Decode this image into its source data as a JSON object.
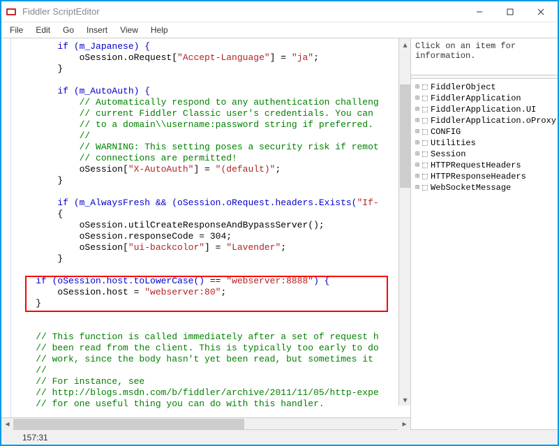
{
  "window": {
    "title": "Fiddler ScriptEditor"
  },
  "menu": {
    "file": "File",
    "edit": "Edit",
    "go": "Go",
    "insert": "Insert",
    "view": "View",
    "help": "Help"
  },
  "code": {
    "l1": "        if (m_Japanese) {",
    "l2a": "            oSession.oRequest[",
    "l2s": "\"Accept-Language\"",
    "l2b": "] = ",
    "l2s2": "\"ja\"",
    "l2c": ";",
    "l3": "        }",
    "l5": "        if (m_AutoAuth) {",
    "l6c": "            // Automatically respond to any authentication challeng",
    "l7c": "            // current Fiddler Classic user's credentials. You can ",
    "l8c": "            // to a domain\\\\username:password string if preferred.",
    "l9c": "            //",
    "l10c": "            // WARNING: This setting poses a security risk if remot",
    "l11c": "            // connections are permitted!",
    "l12a": "            oSession[",
    "l12s": "\"X-AutoAuth\"",
    "l12b": "] = ",
    "l12s2": "\"(default)\"",
    "l12c": ";",
    "l13": "        }",
    "l15a": "        if (m_AlwaysFresh && (oSession.oRequest.headers.Exists(",
    "l15s": "\"If-",
    "l16": "        {",
    "l17": "            oSession.utilCreateResponseAndBypassServer();",
    "l18": "            oSession.responseCode = 304;",
    "l19a": "            oSession[",
    "l19s": "\"ui-backcolor\"",
    "l19b": "] = ",
    "l19s2": "\"Lavender\"",
    "l19c": ";",
    "l20": "        }",
    "l22a": "    if (oSession.host.toLowerCase() == ",
    "l22s": "\"webserver:8888\"",
    "l22b": ") {",
    "l23a": "        oSession.host = ",
    "l23s": "\"webserver:80\"",
    "l23b": ";",
    "l24": "    }",
    "l27c": "    // This function is called immediately after a set of request h",
    "l28c": "    // been read from the client. This is typically too early to do",
    "l29c": "    // work, since the body hasn't yet been read, but sometimes it ",
    "l30c": "    //",
    "l31c": "    // For instance, see",
    "l32c": "    // http://blogs.msdn.com/b/fiddler/archive/2011/11/05/http-expe",
    "l33c": "    // for one useful thing you can do with this handler."
  },
  "info": {
    "text": "Click on an item for\ninformation."
  },
  "tree": {
    "items": [
      "FiddlerObject",
      "FiddlerApplication",
      "FiddlerApplication.UI",
      "FiddlerApplication.oProxy",
      "CONFIG",
      "Utilities",
      "Session",
      "HTTPRequestHeaders",
      "HTTPResponseHeaders",
      "WebSocketMessage"
    ]
  },
  "status": {
    "position": "157:31"
  }
}
